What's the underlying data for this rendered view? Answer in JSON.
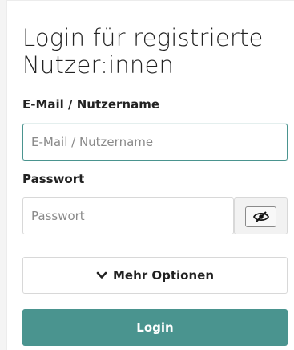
{
  "login_form": {
    "title": "Login für registrierte Nutzer:innen",
    "email": {
      "label": "E-Mail / Nutzername",
      "value": "",
      "placeholder": "E-Mail / Nutzername"
    },
    "password": {
      "label": "Passwort",
      "value": "",
      "placeholder": "Passwort",
      "toggle_icon": "eye-slash-icon"
    },
    "more_options": {
      "icon": "chevron-down-icon",
      "label": "Mehr Optionen"
    },
    "submit": {
      "label": "Login"
    }
  },
  "colors": {
    "accent": "#4a948f",
    "text": "#222222",
    "border": "#d8d8d8",
    "placeholder": "#8a8a8a"
  }
}
